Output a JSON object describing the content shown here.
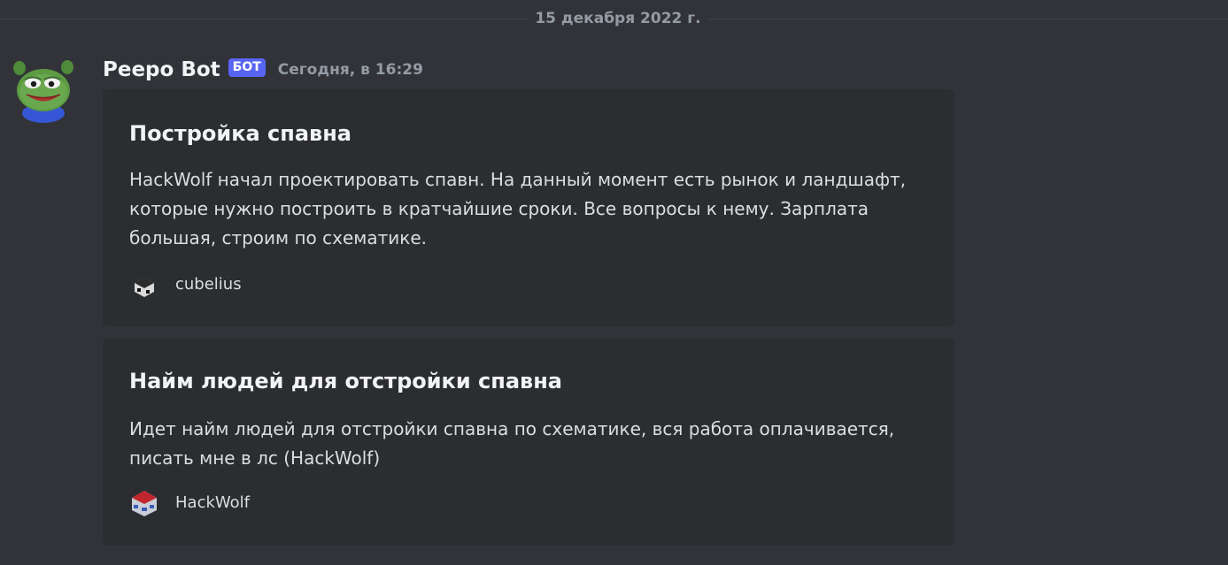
{
  "date_divider": "15 декабря 2022 г.",
  "message": {
    "author": "Peepo Bot",
    "bot_tag": "БОТ",
    "timestamp": "Сегодня, в 16:29",
    "avatar_icon": "peepo-frog-avatar"
  },
  "embeds": [
    {
      "title": "Постройка спавна",
      "description": "HackWolf начал проектировать спавн. На данный момент есть рынок и ландшафт, которые нужно построить в кратчайшие сроки. Все вопросы к нему. Зарплата большая, строим по схематике.",
      "footer": "cubelius",
      "footer_icon": "cubelius-skin-icon"
    },
    {
      "title": "Найм людей для отстройки спавна",
      "description": "Идет найм людей для отстройки спавна по схематике, вся работа оплачивается, писать мне в лс (HackWolf)",
      "footer": "HackWolf",
      "footer_icon": "hackwolf-skin-icon"
    }
  ],
  "colors": {
    "background": "#313338",
    "embed_background": "#2b2d31",
    "bot_tag": "#5865f2",
    "muted_text": "#949ba4"
  }
}
